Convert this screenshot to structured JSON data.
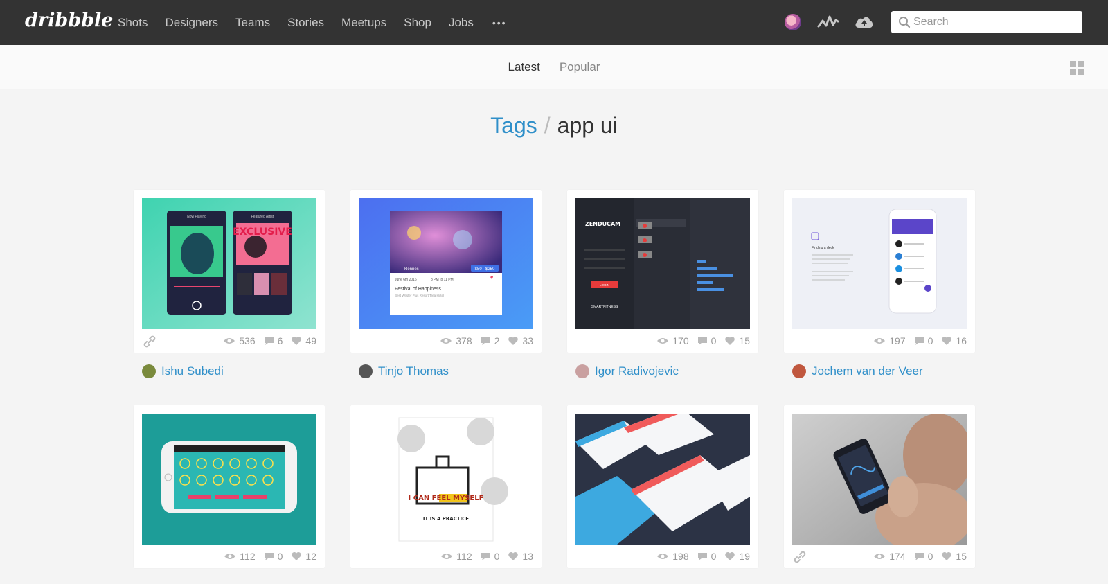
{
  "header": {
    "logo": "dribbble",
    "nav": [
      "Shots",
      "Designers",
      "Teams",
      "Stories",
      "Meetups",
      "Shop",
      "Jobs"
    ],
    "more": "•••",
    "search_placeholder": "Search"
  },
  "subnav": {
    "tabs": [
      "Latest",
      "Popular"
    ],
    "active": "Latest"
  },
  "heading": {
    "crumb": "Tags",
    "separator": "/",
    "tag": "app ui"
  },
  "shots": [
    {
      "views": "536",
      "comments": "6",
      "likes": "49",
      "author": "Ishu Subedi",
      "has_link": true
    },
    {
      "views": "378",
      "comments": "2",
      "likes": "33",
      "author": "Tinjo Thomas",
      "has_link": false
    },
    {
      "views": "170",
      "comments": "0",
      "likes": "15",
      "author": "Igor Radivojevic",
      "has_link": false
    },
    {
      "views": "197",
      "comments": "0",
      "likes": "16",
      "author": "Jochem van der Veer",
      "has_link": false
    },
    {
      "views": "112",
      "comments": "0",
      "likes": "12",
      "has_link": false
    },
    {
      "views": "112",
      "comments": "0",
      "likes": "13",
      "has_link": false
    },
    {
      "views": "198",
      "comments": "0",
      "likes": "19",
      "has_link": false
    },
    {
      "views": "174",
      "comments": "0",
      "likes": "15",
      "has_link": true
    }
  ],
  "thumb_text": {
    "s1_title1": "Now Playing",
    "s1_title2": "Featured Artist",
    "s1_word": "EXCLUSIVE",
    "s2_city": "Rennes",
    "s2_price": "$50 - $250",
    "s2_date": "June 6th 2016",
    "s2_time": "8 PM to 11 PM",
    "s2_event": "Festival of Happiness",
    "s2_place": "Best Wester Plus Resort Trea Hotel",
    "s3_brand": "ZENDUCAM",
    "s3_button": "LOGIN",
    "s3_footer": "SMARTFITNESS",
    "s4_title": "Finding a deck",
    "s6_line1": "I CAN FEEL MYSELF",
    "s6_line2": "IT IS A PRACTICE"
  },
  "colors": {
    "topbar": "#333333",
    "link": "#2f8fc9",
    "background": "#f4f4f4"
  }
}
